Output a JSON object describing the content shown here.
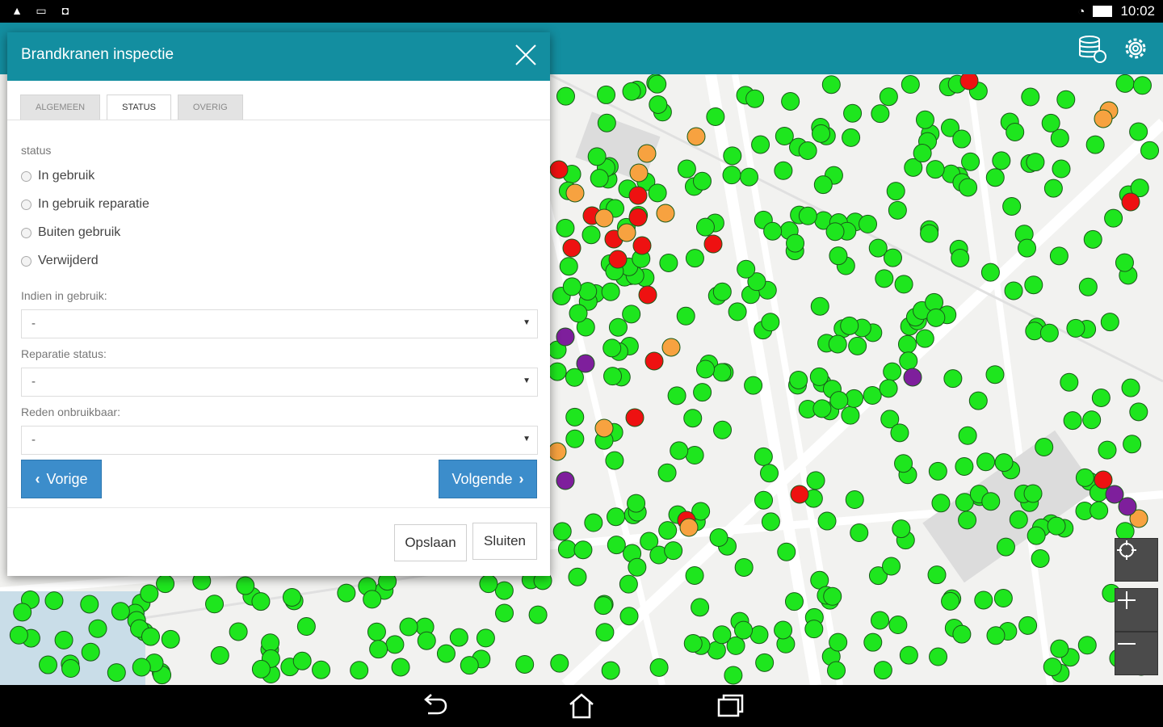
{
  "statusbar": {
    "time": "10:02"
  },
  "dialog": {
    "title": "Brandkranen inspectie",
    "tabs": [
      "ALGEMEEN",
      "STATUS",
      "OVERIG"
    ],
    "active_tab": "STATUS",
    "status_label": "status",
    "status_options": [
      "In gebruik",
      "In gebruik reparatie",
      "Buiten gebruik",
      "Verwijderd"
    ],
    "indien_label": "Indien in gebruik:",
    "indien_value": "-",
    "reparatie_label": "Reparatie status:",
    "reparatie_value": "-",
    "reden_label": "Reden onbruikbaar:",
    "reden_value": "-",
    "prev_label": "Vorige",
    "next_label": "Volgende",
    "save_label": "Opslaan",
    "close_label": "Sluiten"
  },
  "colors": {
    "teal": "#138ea0",
    "green": "#1ee61e",
    "red": "#ee1111",
    "orange": "#f7a240",
    "purple": "#7e1f9c",
    "blue_button": "#3c8dcb"
  }
}
